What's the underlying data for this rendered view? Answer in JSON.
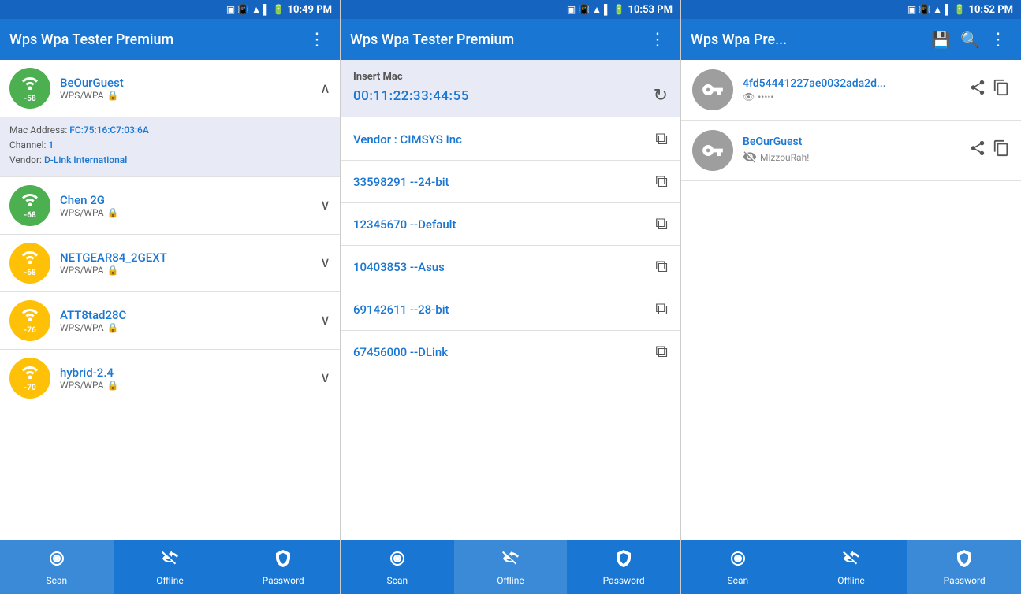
{
  "panels": [
    {
      "id": "panel1",
      "statusBar": {
        "time": "10:49 PM",
        "icons": [
          "screenshot",
          "vibrate",
          "wifi",
          "signal",
          "battery"
        ]
      },
      "appBar": {
        "title": "Wps Wpa Tester Premium",
        "menuIcon": "⋮"
      },
      "networks": [
        {
          "name": "BeOurGuest",
          "type": "WPS/WPA",
          "signal": -58,
          "signalLevel": "high",
          "color": "green",
          "expanded": true,
          "mac": "FC:75:16:C7:03:6A",
          "channel": "1",
          "vendor": "D-Link International"
        },
        {
          "name": "Chen 2G",
          "type": "WPS/WPA",
          "signal": -68,
          "signalLevel": "medium",
          "color": "green",
          "expanded": false
        },
        {
          "name": "NETGEAR84_2GEXT",
          "type": "WPS/WPA",
          "signal": -68,
          "signalLevel": "medium",
          "color": "yellow",
          "expanded": false
        },
        {
          "name": "ATT8tad28C",
          "type": "WPS/WPA",
          "signal": -76,
          "signalLevel": "low",
          "color": "yellow",
          "expanded": false
        },
        {
          "name": "hybrid-2.4",
          "type": "WPS/WPA",
          "signal": -70,
          "signalLevel": "low",
          "color": "yellow",
          "expanded": false
        }
      ],
      "bottomTabs": [
        {
          "id": "scan",
          "label": "Scan",
          "active": true,
          "icon": "wifi_tethering"
        },
        {
          "id": "offline",
          "label": "Offline",
          "active": false,
          "icon": "wifi_off"
        },
        {
          "id": "password",
          "label": "Password",
          "active": false,
          "icon": "shield"
        }
      ]
    },
    {
      "id": "panel2",
      "statusBar": {
        "time": "10:53 PM",
        "icons": [
          "screenshot",
          "vibrate",
          "wifi",
          "signal",
          "battery"
        ]
      },
      "appBar": {
        "title": "Wps Wpa Tester Premium",
        "menuIcon": "⋮"
      },
      "macSection": {
        "label": "Insert Mac",
        "value": "00:11:22:33:44:55"
      },
      "results": [
        {
          "text": "Vendor : CIMSYS Inc"
        },
        {
          "text": "33598291 --24-bit"
        },
        {
          "text": "12345670 --Default"
        },
        {
          "text": "10403853 --Asus"
        },
        {
          "text": "69142611 --28-bit"
        },
        {
          "text": "67456000 --DLink"
        }
      ],
      "bottomTabs": [
        {
          "id": "scan",
          "label": "Scan",
          "active": false,
          "icon": "wifi_tethering"
        },
        {
          "id": "offline",
          "label": "Offline",
          "active": true,
          "icon": "wifi_off"
        },
        {
          "id": "password",
          "label": "Password",
          "active": false,
          "icon": "shield"
        }
      ]
    },
    {
      "id": "panel3",
      "statusBar": {
        "time": "10:52 PM",
        "icons": [
          "screenshot",
          "vibrate",
          "wifi",
          "signal",
          "battery"
        ]
      },
      "appBar": {
        "title": "Wps Wpa Pre...",
        "extraIcons": [
          "save",
          "search",
          "menu"
        ]
      },
      "savedPasswords": [
        {
          "name": "4fd54441227ae0032ada2d...",
          "password": "•••••",
          "visible": true
        },
        {
          "name": "BeOurGuest",
          "password": "MizzouRah!",
          "visible": false
        }
      ],
      "bottomTabs": [
        {
          "id": "scan",
          "label": "Scan",
          "active": false,
          "icon": "wifi_tethering"
        },
        {
          "id": "offline",
          "label": "Offline",
          "active": false,
          "icon": "wifi_off"
        },
        {
          "id": "password",
          "label": "Password",
          "active": true,
          "icon": "shield"
        }
      ]
    }
  ]
}
